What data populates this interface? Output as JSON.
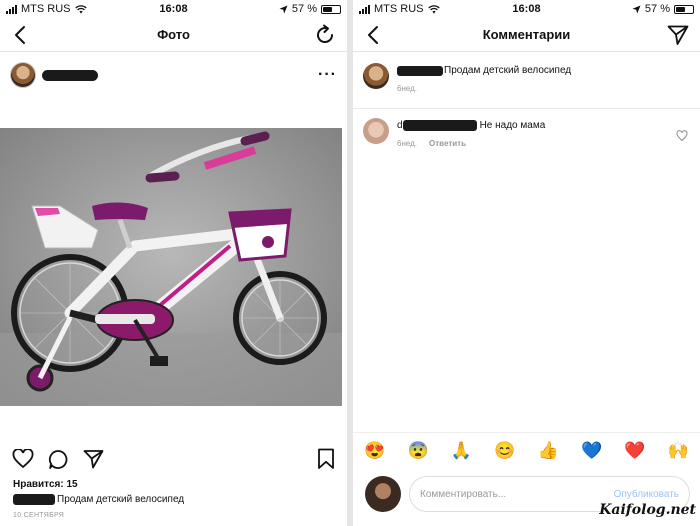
{
  "status_bar": {
    "carrier": "MTS RUS",
    "time": "16:08",
    "battery": "57 %",
    "battery_level": 0.57
  },
  "left_screen": {
    "nav": {
      "title": "Фото"
    },
    "post": {
      "likes": "Нравится: 15",
      "caption": "Продам детский велосипед",
      "date": "10 СЕНТЯБРЯ"
    }
  },
  "right_screen": {
    "nav": {
      "title": "Комментарии"
    },
    "comments": [
      {
        "text": "Продам детский велосипед",
        "time": "6нед.",
        "reply": ""
      },
      {
        "prefix": "d",
        "text": "Не надо мама",
        "time": "6нед.",
        "reply": "Ответить"
      }
    ],
    "emojis": [
      "😍",
      "😨",
      "🙏",
      "😊",
      "👍",
      "💙",
      "❤️",
      "🙌"
    ],
    "composer": {
      "placeholder": "Комментировать...",
      "publish": "Опубликовать"
    }
  },
  "watermark": "Kaifolog.net"
}
